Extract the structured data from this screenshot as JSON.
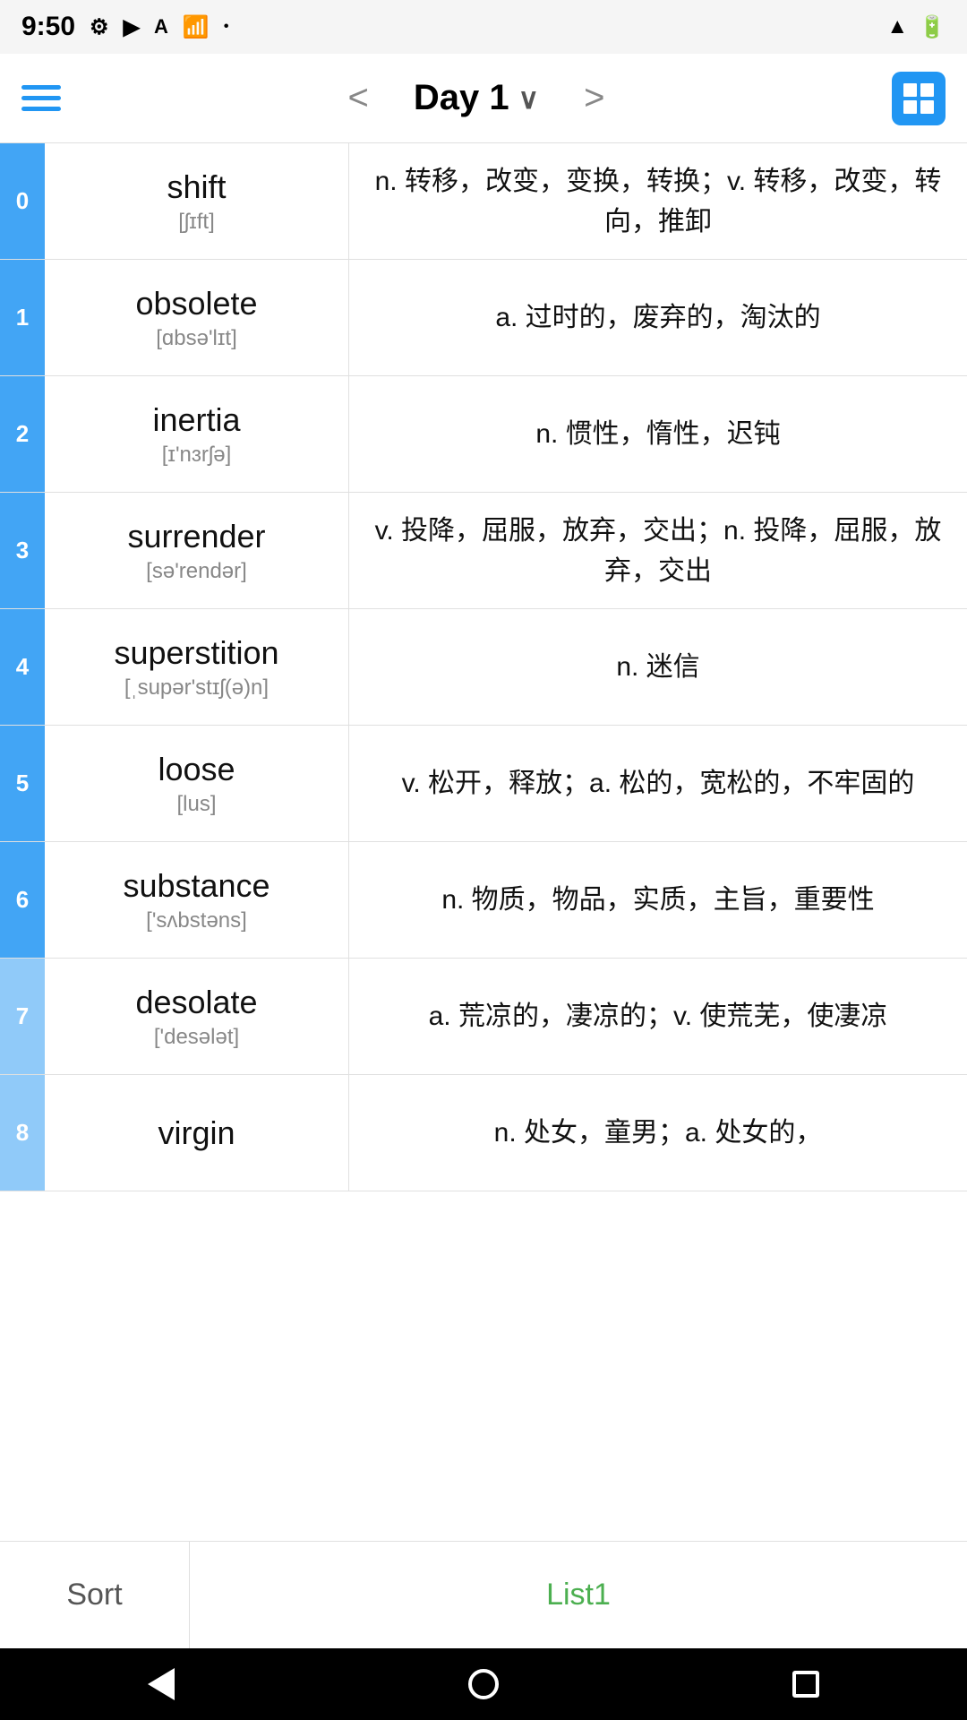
{
  "statusBar": {
    "time": "9:50",
    "icons": [
      "gear",
      "play",
      "a",
      "wifi",
      "dot",
      "signal",
      "battery"
    ]
  },
  "topNav": {
    "prevLabel": "<",
    "title": "Day 1",
    "titleChevron": "∨",
    "nextLabel": ">",
    "gridIconLabel": "grid"
  },
  "words": [
    {
      "index": "0",
      "word": "shift",
      "phonetic": "[ʃɪft]",
      "definition": "n. 转移，改变，变换，转换；v. 转移，改变，转向，推卸",
      "indexLight": false
    },
    {
      "index": "1",
      "word": "obsolete",
      "phonetic": "[ɑbsə'lɪt]",
      "definition": "a. 过时的，废弃的，淘汰的",
      "indexLight": false
    },
    {
      "index": "2",
      "word": "inertia",
      "phonetic": "[ɪ'nɜrʃə]",
      "definition": "n. 惯性，惰性，迟钝",
      "indexLight": false
    },
    {
      "index": "3",
      "word": "surrender",
      "phonetic": "[sə'rendər]",
      "definition": "v. 投降，屈服，放弃，交出；n. 投降，屈服，放弃，交出",
      "indexLight": false
    },
    {
      "index": "4",
      "word": "superstition",
      "phonetic": "[ˌsupər'stɪʃ(ə)n]",
      "definition": "n. 迷信",
      "indexLight": false
    },
    {
      "index": "5",
      "word": "loose",
      "phonetic": "[lus]",
      "definition": "v. 松开，释放；a. 松的，宽松的，不牢固的",
      "indexLight": false
    },
    {
      "index": "6",
      "word": "substance",
      "phonetic": "['sʌbstəns]",
      "definition": "n. 物质，物品，实质，主旨，重要性",
      "indexLight": false
    },
    {
      "index": "7",
      "word": "desolate",
      "phonetic": "['desələt]",
      "definition": "a. 荒凉的，凄凉的；v. 使荒芜，使凄凉",
      "indexLight": true
    },
    {
      "index": "8",
      "word": "virgin",
      "phonetic": "",
      "definition": "n. 处女，童男；a. 处女的，",
      "indexLight": true
    }
  ],
  "bottomTabs": {
    "sortLabel": "Sort",
    "list1Label": "List1"
  },
  "androidNav": {
    "back": "back",
    "home": "home",
    "recent": "recent"
  }
}
